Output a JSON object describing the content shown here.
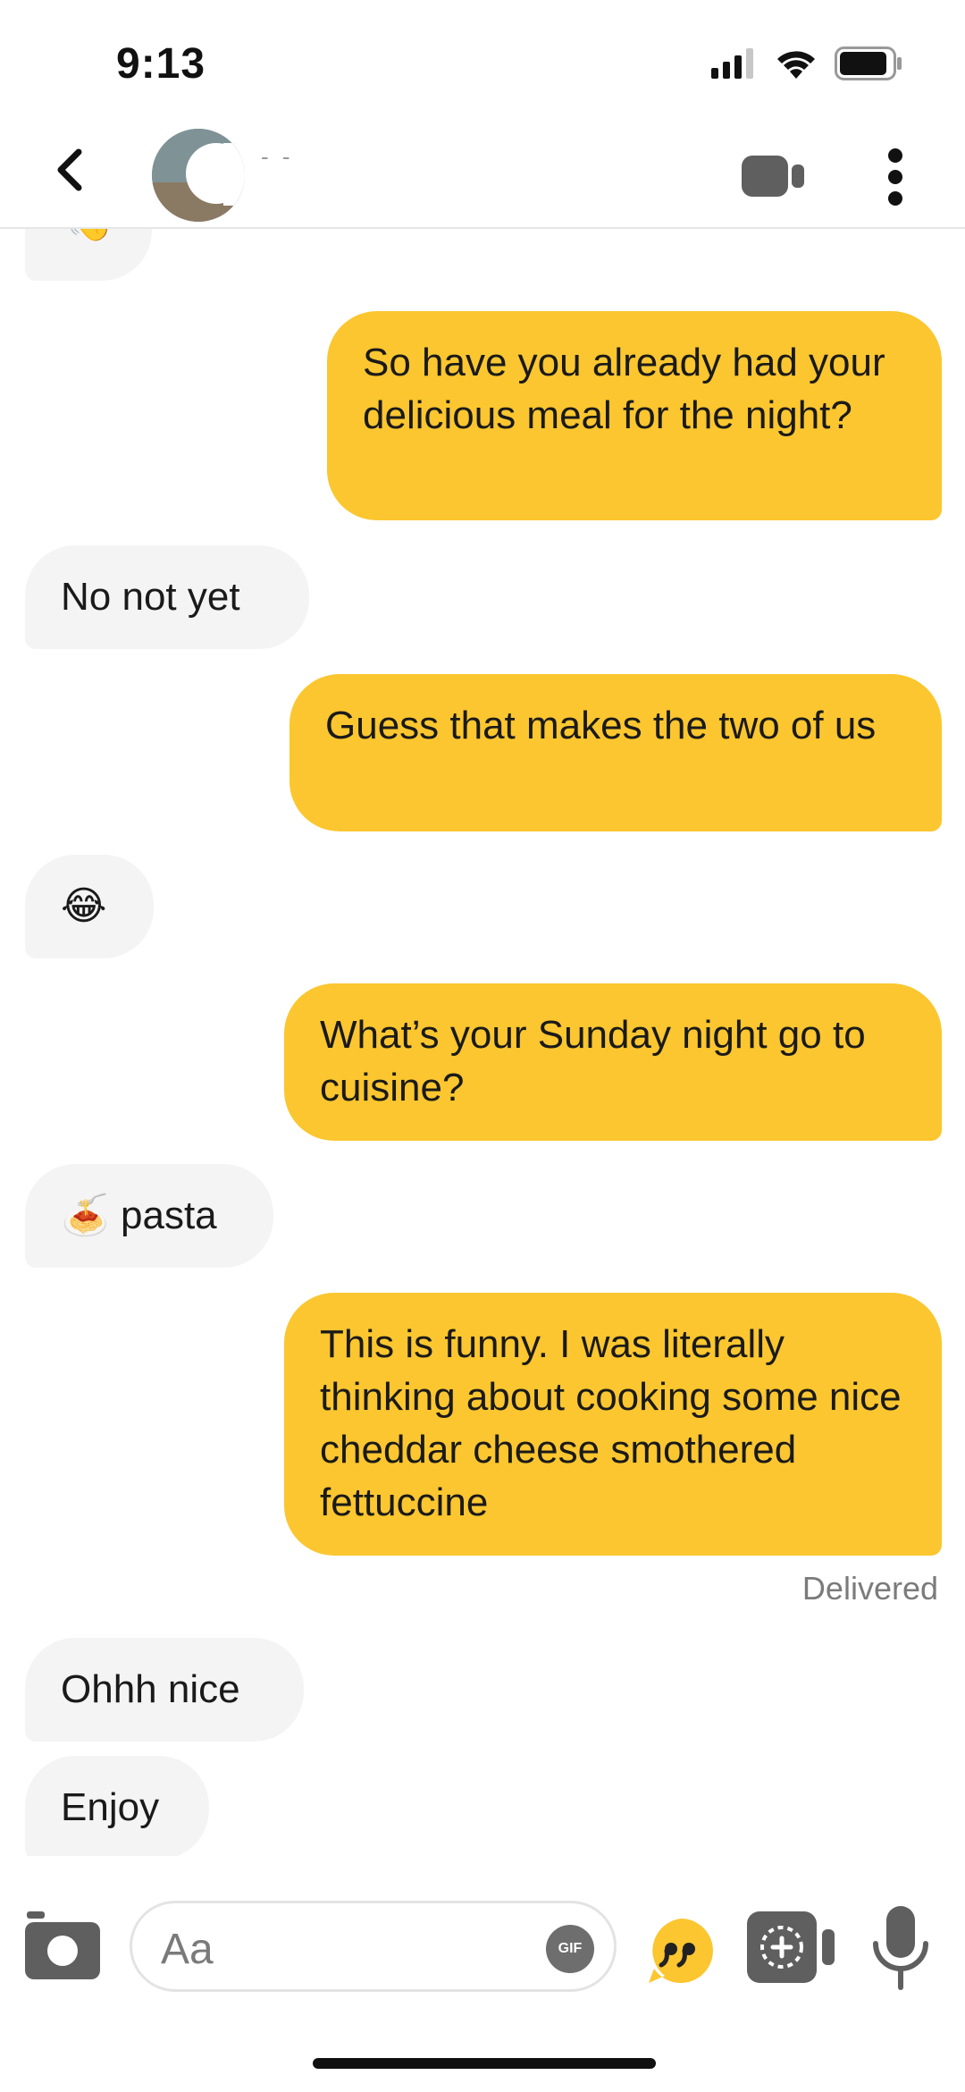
{
  "status": {
    "time": "9:13"
  },
  "header": {
    "contact_name": "- -"
  },
  "messages": [
    {
      "side": "in",
      "text": "👋"
    },
    {
      "side": "out",
      "text": "So have you already had your delicious meal for the night?"
    },
    {
      "side": "in",
      "text": "No not yet"
    },
    {
      "side": "out",
      "text": "Guess that makes the two of us"
    },
    {
      "side": "in",
      "text": "😂"
    },
    {
      "side": "out",
      "text": "What’s your Sunday night go to cuisine?"
    },
    {
      "side": "in",
      "text": "🍝 pasta"
    },
    {
      "side": "out",
      "text": "This is funny. I was literally thinking about cooking some nice cheddar cheese smothered fettuccine"
    },
    {
      "side": "in",
      "text": "Ohhh nice"
    },
    {
      "side": "in",
      "text": "Enjoy"
    }
  ],
  "delivered_label": "Delivered",
  "composer": {
    "placeholder": "Aa",
    "gif_label": "GIF"
  },
  "colors": {
    "accent": "#fbc62f",
    "incoming_bubble": "#f4f4f4",
    "icon_gray": "#5f5f5f"
  }
}
